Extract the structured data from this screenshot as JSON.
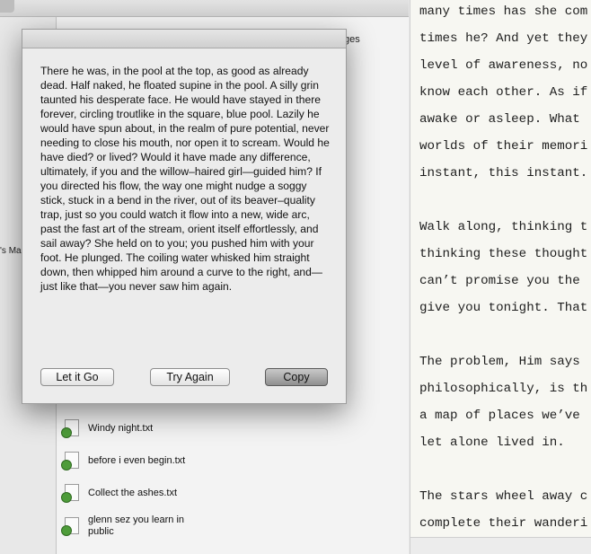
{
  "browser": {
    "partial_sidebar_label": "'s Ma",
    "partial_file_label": "ges",
    "files": [
      {
        "name": "Windy night.txt"
      },
      {
        "name": "before i even begin.txt"
      },
      {
        "name": "Collect the ashes.txt"
      },
      {
        "name": "glenn sez you learn in public"
      }
    ]
  },
  "editor": {
    "lines": [
      "many times has she com",
      "times he? And yet they",
      "level of awareness, no",
      "know each other. As if",
      "awake or asleep. What ",
      "worlds of their memori",
      "instant, this instant.",
      "",
      "Walk along, thinking t",
      "thinking these thought",
      "can’t promise you the ",
      "give you tonight. That",
      "",
      "The problem, Him says ",
      "philosophically, is th",
      "a map of places we’ve ",
      "let alone lived in.",
      "",
      "The stars wheel away c",
      "complete their wanderi"
    ]
  },
  "dialog": {
    "text": "There he was, in the pool at the top, as good as already dead. Half naked, he floated supine in the pool. A silly grin taunted his desperate face. He would have stayed in there forever, circling troutlike in the square, blue pool. Lazily he would have spun about, in the realm of pure potential, never needing to close his mouth, nor open it to scream. Would he have died? or lived? Would it have made any difference, ultimately, if you and the willow–haired girl—guided him? If you directed his flow, the way one might nudge a soggy stick, stuck in a bend in the river, out of its beaver–quality trap, just so you could watch it flow into a new, wide arc, past the fast art of the stream, orient itself effortlessly, and sail away? She held on to you; you pushed him with your foot. He plunged. The coiling water whisked him straight down, then whipped him around a curve to the right, and—just like that—you never saw him again.",
    "buttons": {
      "let_it_go": "Let it Go",
      "try_again": "Try Again",
      "copy": "Copy"
    }
  }
}
